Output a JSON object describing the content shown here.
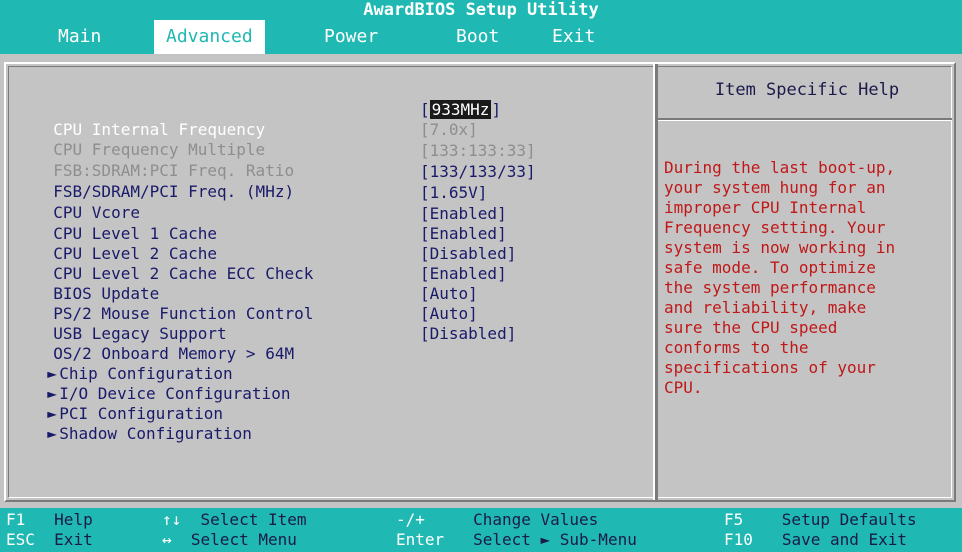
{
  "window": {
    "title": "AwardBIOS Setup Utility"
  },
  "menu": [
    {
      "label": "Main"
    },
    {
      "label": "Advanced"
    },
    {
      "label": "Power"
    },
    {
      "label": "Boot"
    },
    {
      "label": "Exit"
    }
  ],
  "settings": [
    {
      "label": "CPU Internal Frequency",
      "value_open": "[",
      "value_sel": "933MHz",
      "value_close": "]"
    },
    {
      "label": "CPU Frequency Multiple",
      "value": "[7.0x]"
    },
    {
      "label": "FSB:SDRAM:PCI Freq. Ratio",
      "value": "[133:133:33]"
    },
    {
      "label": "FSB/SDRAM/PCI Freq. (MHz)",
      "value": "[133/133/33]"
    },
    {
      "label": "CPU Vcore",
      "value": "[1.65V]"
    },
    {
      "label": "CPU Level 1 Cache",
      "value": "[Enabled]"
    },
    {
      "label": "CPU Level 2 Cache",
      "value": "[Enabled]"
    },
    {
      "label": "CPU Level 2 Cache ECC Check",
      "value": "[Disabled]"
    },
    {
      "label": "BIOS Update",
      "value": "[Enabled]"
    },
    {
      "label": "PS/2 Mouse Function Control",
      "value": "[Auto]"
    },
    {
      "label": "USB Legacy Support",
      "value": "[Auto]"
    },
    {
      "label": "OS/2 Onboard Memory > 64M",
      "value": "[Disabled]"
    }
  ],
  "submenus": [
    {
      "label": "Chip Configuration"
    },
    {
      "label": "I/O Device Configuration"
    },
    {
      "label": "PCI Configuration"
    },
    {
      "label": "Shadow Configuration"
    }
  ],
  "help": {
    "title": "Item Specific Help",
    "text": "During the last boot-up,\nyour system hung for an\nimproper CPU Internal\nFrequency setting. Your\nsystem is now working in\nsafe mode. To optimize\nthe system performance\nand reliability, make\nsure the CPU speed\nconforms to the\nspecifications of your\nCPU."
  },
  "footer": {
    "f1_key": "F1",
    "f1_desc": "Help",
    "esc_key": "ESC",
    "esc_desc": "Exit",
    "ud_key": "↑↓",
    "ud_desc": "Select Item",
    "lr_key": "↔",
    "lr_desc": "Select Menu",
    "pm_key": "-/+",
    "pm_desc": "Change Values",
    "enter_key": "Enter",
    "enter_desc": "Select ► Sub-Menu",
    "f5_key": "F5",
    "f5_desc": "Setup Defaults",
    "f10_key": "F10",
    "f10_desc": "Save and Exit"
  },
  "colors": {
    "accent": "#1fb8b2",
    "panel": "#c4c4c4",
    "help_text": "#c01818"
  }
}
